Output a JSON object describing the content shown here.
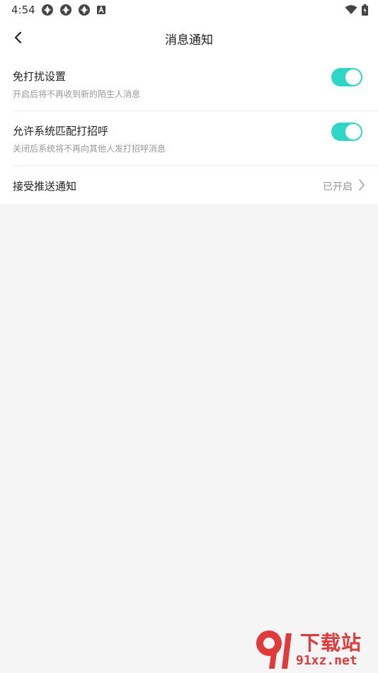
{
  "status_bar": {
    "time": "4:54",
    "left_icons": [
      "app-shutter-icon",
      "app-shutter-icon",
      "app-shutter-icon",
      "a-box-icon"
    ],
    "right_icons": [
      "wifi-icon",
      "battery-charging-icon"
    ]
  },
  "header": {
    "title": "消息通知",
    "back_icon": "chevron-left-icon"
  },
  "settings": {
    "dnd": {
      "title": "免打扰设置",
      "subtitle": "开启后将不再收到新的陌生人消息",
      "enabled": true
    },
    "match_greet": {
      "title": "允许系统匹配打招呼",
      "subtitle": "关闭后系统将不再向其他人发打招呼消息",
      "enabled": true
    },
    "push": {
      "title": "接受推送通知",
      "value": "已开启"
    }
  },
  "watermark": {
    "logo_text": "91",
    "title": "下载站",
    "domain": "91xz.net"
  },
  "colors": {
    "accent": "#2ed6c5",
    "background": "#f5f5f5",
    "watermark": "#e03a3a"
  }
}
